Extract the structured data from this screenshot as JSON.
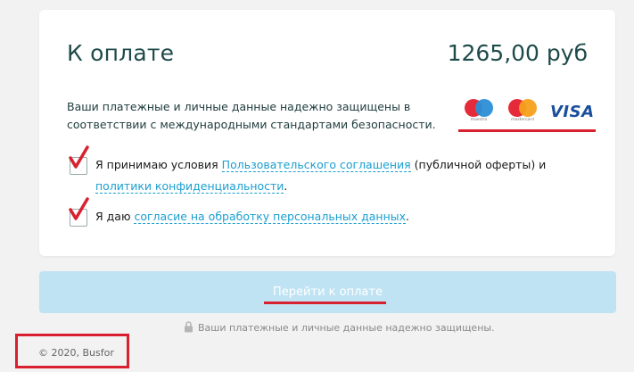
{
  "payment": {
    "title": "К оплате",
    "amount": "1265,00 руб",
    "security_text": "Ваши платежные и личные данные надежно защищены в соответствии с международными стандартами безопасности."
  },
  "logos": {
    "maestro_caption": "maestro",
    "mastercard_caption": "mastercard",
    "visa": "VISA"
  },
  "agreement_1": {
    "prefix": "Я принимаю условия ",
    "link1": "Пользовательского соглашения",
    "middle": " (публичной оферты) и ",
    "link2": "политики конфиденциальности",
    "suffix": ".",
    "checked": true
  },
  "agreement_2": {
    "prefix": "Я даю ",
    "link": "согласие на обработку персональных данных",
    "suffix": ".",
    "checked": true
  },
  "pay_button": {
    "label": "Перейти к оплате"
  },
  "secure_note": "Ваши платежные и личные данные надежно защищены.",
  "footer": {
    "copyright": "© 2020, Busfor"
  },
  "colors": {
    "accent_red": "#d8202f",
    "link_blue": "#1a9fd0",
    "button_bg": "#bfe3f3",
    "title_green": "#1f4a4a"
  }
}
